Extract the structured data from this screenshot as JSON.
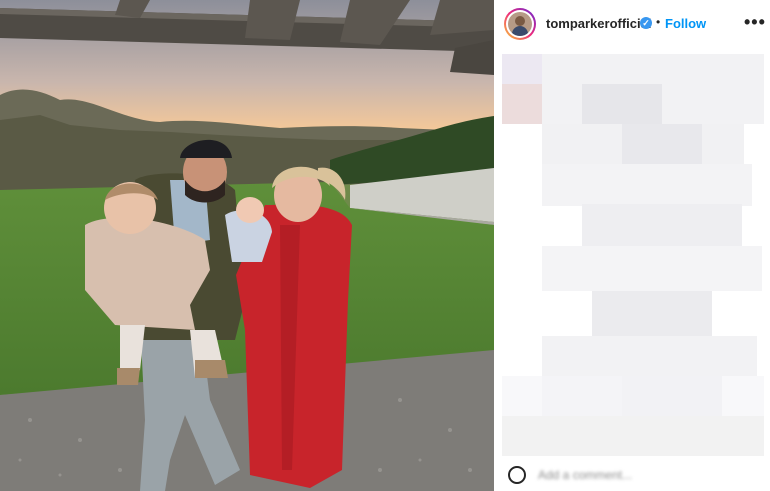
{
  "post": {
    "username": "tomparkerofficial",
    "verified_mark": "✓",
    "separator": "•",
    "follow_label": "Follow",
    "more_label": "•••",
    "comment_placeholder": "Add a comment...",
    "icons": {
      "verified": "verified-badge-icon",
      "more": "more-options-icon",
      "emoji": "emoji-icon"
    },
    "colors": {
      "follow": "#0095f6",
      "verified": "#3897f0",
      "username": "#262626"
    }
  }
}
